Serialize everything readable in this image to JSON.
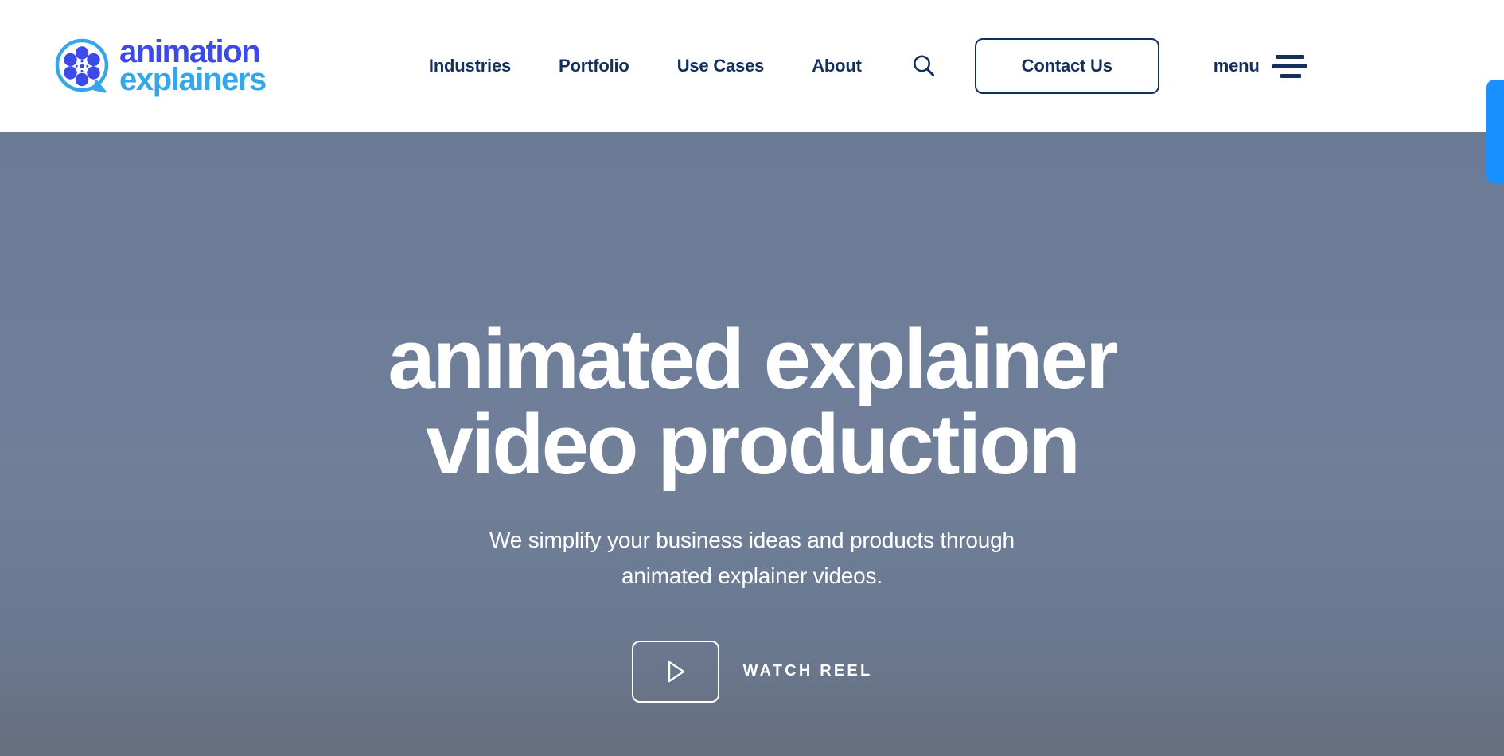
{
  "header": {
    "logo": {
      "icon": "film-reel-speech-bubble-logo",
      "line1": "animation",
      "line2": "explainers",
      "line1_color": "#3b4ae8",
      "line2_color": "#35a7e8"
    },
    "nav": [
      {
        "label": "Industries",
        "name": "nav-link-industries"
      },
      {
        "label": "Portfolio",
        "name": "nav-link-portfolio"
      },
      {
        "label": "Use Cases",
        "name": "nav-link-use-cases"
      },
      {
        "label": "About",
        "name": "nav-link-about"
      }
    ],
    "search_icon": "search-icon",
    "contact_label": "Contact Us",
    "menu_label": "menu",
    "menu_icon": "hamburger-menu-icon",
    "nav_color": "#13305c",
    "side_tab_color": "#1890ff"
  },
  "hero": {
    "title_line1": "animated explainer",
    "title_line2": "video production",
    "sub_line1": "We simplify your business ideas and products through",
    "sub_line2": "animated explainer videos.",
    "reel_label": "WATCH REEL",
    "play_icon": "play-triangle-icon",
    "background_color": "#6d7d98"
  }
}
